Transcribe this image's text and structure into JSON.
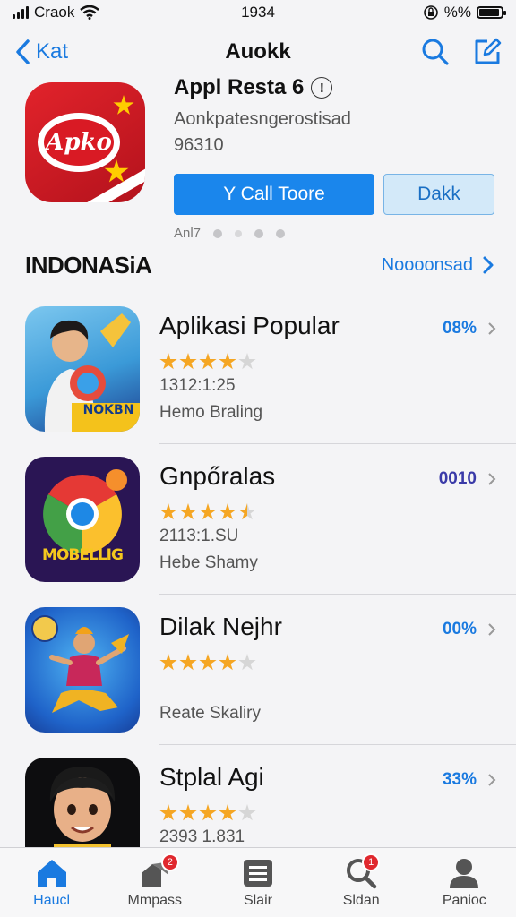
{
  "status_bar": {
    "carrier": "Craok",
    "time": "1934",
    "battery_text": "%%",
    "battery_level": 0.9
  },
  "nav": {
    "back_label": "Kat",
    "title": "Auokk"
  },
  "hero": {
    "icon_text": "Apko",
    "title": "Appl Resta 6",
    "subtitle": "Aonkpatesngerostisad",
    "code": "96310",
    "primary_button": "Y Call Toore",
    "secondary_button": "Dakk",
    "pager_label": "Anl7"
  },
  "section": {
    "title": "INDONASiA",
    "link": "Noooonsad"
  },
  "apps": [
    {
      "name": "Aplikasi Popular",
      "rating": 4,
      "meta": "1312:1:25",
      "category": "Hemo Braling",
      "price": "08%",
      "icon_text": "NOKBN"
    },
    {
      "name": "Gnpőralas",
      "rating": 4.5,
      "meta": "2113:1.SU",
      "category": "Hebe Shamy",
      "price": "0010",
      "icon_text": "MOBELLIG"
    },
    {
      "name": "Dilak Nejhr",
      "rating": 4,
      "meta": "",
      "category": "Reate Skaliry",
      "price": "00%",
      "icon_text": ""
    },
    {
      "name": "Stplal Agi",
      "rating": 4,
      "meta": "2393 1.831",
      "category": "",
      "price": "33%",
      "icon_text": ""
    }
  ],
  "tabs": [
    {
      "label": "Haucl",
      "icon": "home-icon",
      "badge": ""
    },
    {
      "label": "Mmpass",
      "icon": "games-icon",
      "badge": "2"
    },
    {
      "label": "Slair",
      "icon": "list-icon",
      "badge": ""
    },
    {
      "label": "Sldan",
      "icon": "search-icon",
      "badge": "1"
    },
    {
      "label": "Panioc",
      "icon": "person-icon",
      "badge": ""
    }
  ],
  "colors": {
    "accent": "#1a7ae0",
    "star": "#f5a623",
    "star_empty": "#d6d6d6",
    "badge": "#e0282e"
  }
}
